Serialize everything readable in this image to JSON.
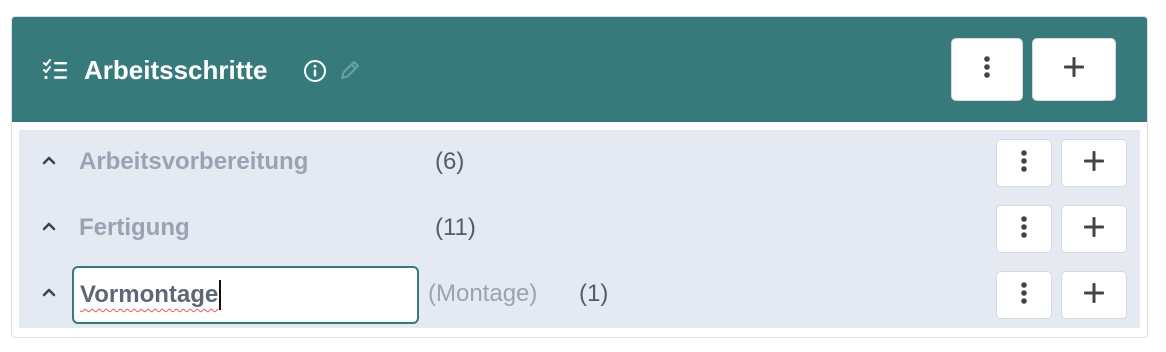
{
  "header": {
    "title": "Arbeitsschritte",
    "icons": [
      "checklist-icon",
      "info-icon",
      "pencil-icon"
    ],
    "menu_icon": "more-vertical-icon",
    "add_icon": "plus-icon"
  },
  "groups": [
    {
      "label": "Arbeitsvorbereitung",
      "count": "(6)"
    },
    {
      "label": "Fertigung",
      "count": "(11)"
    },
    {
      "value": "Vormontage",
      "parent": "(Montage)",
      "count": "(1)"
    }
  ],
  "colors": {
    "header_bg": "#367a7c",
    "body_bg": "#e5e9f1",
    "muted_text": "#9aa3b3",
    "count_text": "#555c66"
  }
}
